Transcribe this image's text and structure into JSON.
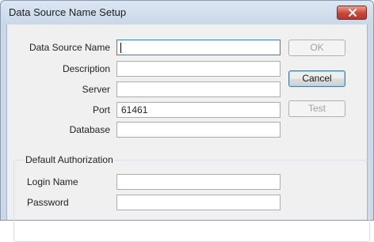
{
  "window": {
    "title": "Data Source Name Setup"
  },
  "fields": {
    "dsn": {
      "label": "Data Source Name",
      "value": ""
    },
    "description": {
      "label": "Description",
      "value": ""
    },
    "server": {
      "label": "Server",
      "value": ""
    },
    "port": {
      "label": "Port",
      "value": "61461"
    },
    "database": {
      "label": "Database",
      "value": ""
    }
  },
  "buttons": {
    "ok": "OK",
    "cancel": "Cancel",
    "test": "Test"
  },
  "auth": {
    "title": "Default Authorization",
    "login": {
      "label": "Login Name",
      "value": ""
    },
    "password": {
      "label": "Password",
      "value": ""
    }
  },
  "icons": {
    "close": "close-icon"
  },
  "colors": {
    "close_button": "#c7463a",
    "focus_border": "#3c7fb1"
  }
}
